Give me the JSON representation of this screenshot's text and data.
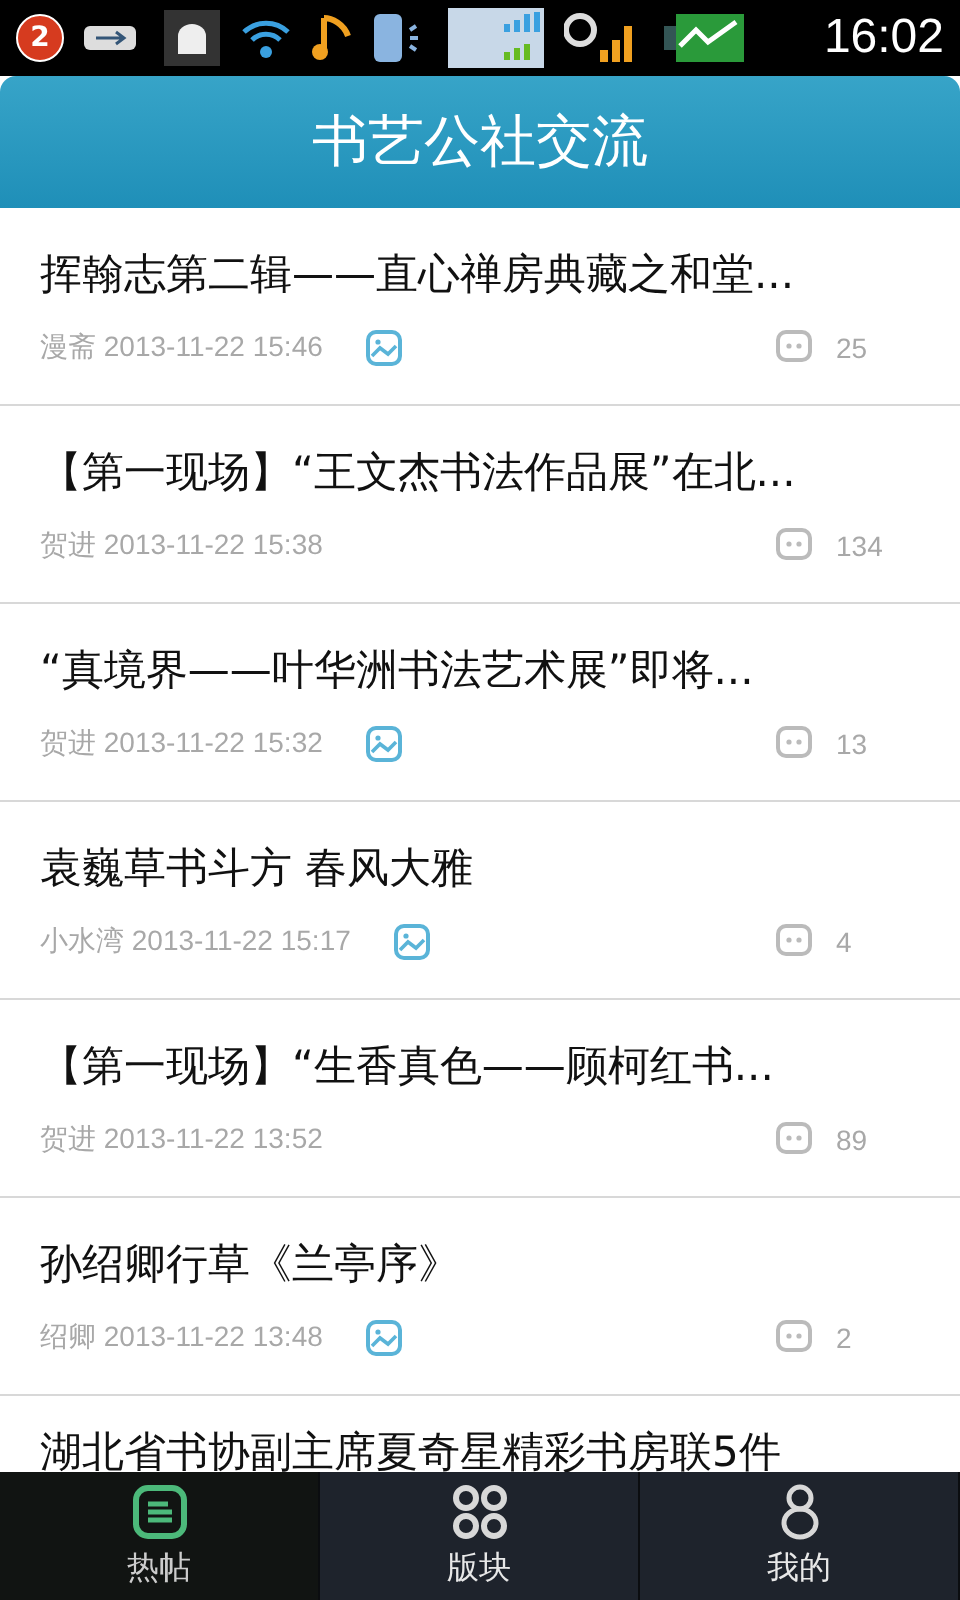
{
  "status_bar": {
    "notification_count": "2",
    "time": "16:02"
  },
  "header": {
    "title": "书艺公社交流"
  },
  "posts": [
    {
      "title": "挥翰志第二辑——直心禅房典藏之和堂...",
      "author": "漫斋",
      "date": "2013-11-22 15:46",
      "has_image": true,
      "comments": "25"
    },
    {
      "title": "【第一现场】“王文杰书法作品展”在北...",
      "author": "贺进",
      "date": "2013-11-22 15:38",
      "has_image": false,
      "comments": "134"
    },
    {
      "title": "“真境界——叶华洲书法艺术展”即将...",
      "author": "贺进",
      "date": "2013-11-22 15:32",
      "has_image": true,
      "comments": "13"
    },
    {
      "title": "袁巍草书斗方 春风大雅",
      "author": "小水湾",
      "date": "2013-11-22 15:17",
      "has_image": true,
      "comments": "4"
    },
    {
      "title": "【第一现场】“生香真色——顾柯红书...",
      "author": "贺进",
      "date": "2013-11-22 13:52",
      "has_image": false,
      "comments": "89"
    },
    {
      "title": "孙绍卿行草《兰亭序》",
      "author": "绍卿",
      "date": "2013-11-22 13:48",
      "has_image": true,
      "comments": "2"
    }
  ],
  "partial_post": {
    "title": "湖北省书协副主席夏奇星精彩书房联5件"
  },
  "tabs": [
    {
      "label": "热帖",
      "kind": "hot",
      "selected": true
    },
    {
      "label": "版块",
      "kind": "grid",
      "selected": false
    },
    {
      "label": "我的",
      "kind": "me",
      "selected": false
    }
  ]
}
